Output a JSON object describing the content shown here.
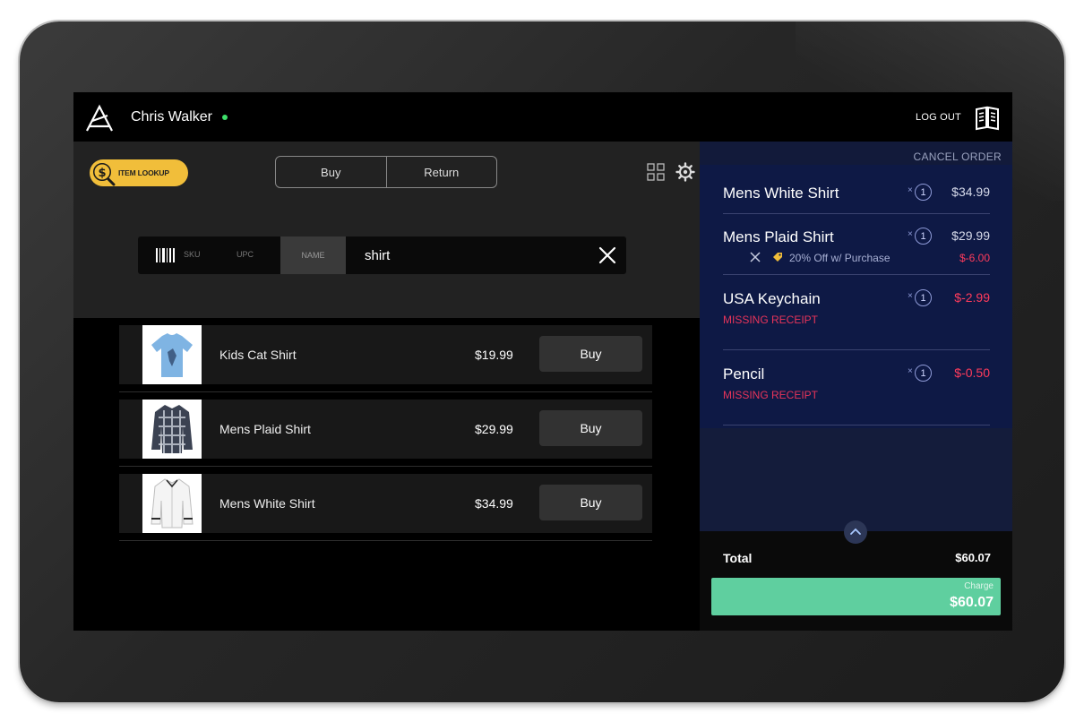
{
  "header": {
    "user_name": "Chris Walker",
    "logout_label": "LOG OUT"
  },
  "toolbar": {
    "item_lookup_label": "ITEM LOOKUP",
    "mode_buttons": [
      "Buy",
      "Return"
    ]
  },
  "search": {
    "tabs": [
      "SKU",
      "UPC",
      "NAME"
    ],
    "selected_tab": "NAME",
    "query": "shirt"
  },
  "results": [
    {
      "name": "Kids Cat Shirt",
      "price": "$19.99",
      "button": "Buy",
      "image": "light-blue-tshirt"
    },
    {
      "name": "Mens Plaid Shirt",
      "price": "$29.99",
      "button": "Buy",
      "image": "plaid-shirt"
    },
    {
      "name": "Mens White Shirt",
      "price": "$34.99",
      "button": "Buy",
      "image": "white-shirt"
    }
  ],
  "cart": {
    "cancel_label": "CANCEL ORDER",
    "items": [
      {
        "name": "Mens White Shirt",
        "qty": "1",
        "price": "$34.99"
      },
      {
        "name": "Mens Plaid Shirt",
        "qty": "1",
        "price": "$29.99",
        "discount_text": "20% Off w/ Purchase",
        "discount_amount": "$-6.00"
      },
      {
        "name": "USA Keychain",
        "qty": "1",
        "price": "$-2.99",
        "note": "MISSING RECEIPT"
      },
      {
        "name": "Pencil",
        "qty": "1",
        "price": "$-0.50",
        "note": "MISSING RECEIPT"
      }
    ],
    "qty_prefix": "×",
    "total_label": "Total",
    "total_value": "$60.07",
    "charge_label": "Charge",
    "charge_value": "$60.07"
  },
  "colors": {
    "accent_yellow": "#f1be3a",
    "charge_green": "#5fcf9f",
    "cart_background": "#0e1945",
    "negative_red": "#ff3b5c",
    "online_green": "#3ee06a"
  },
  "icons": [
    "app-logo-icon",
    "book-icon",
    "dollar-search-icon",
    "grid-icon",
    "gear-icon",
    "barcode-icon",
    "close-icon",
    "tag-icon",
    "chevron-up-icon"
  ]
}
